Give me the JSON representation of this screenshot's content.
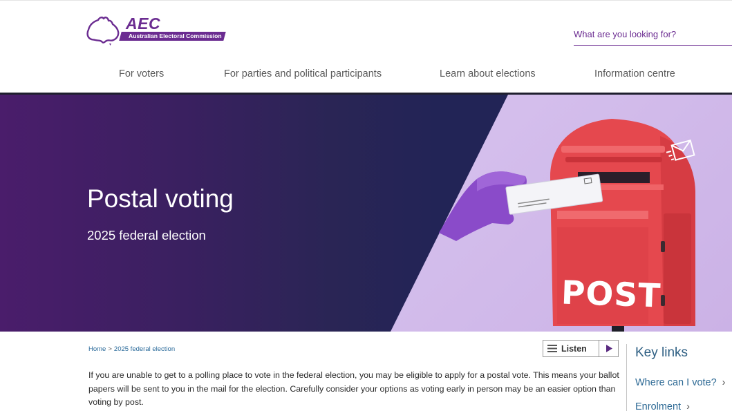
{
  "logo": {
    "abbr": "AEC",
    "full_name": "Australian Electoral Commission"
  },
  "search": {
    "placeholder": "What are you looking for?"
  },
  "nav": {
    "items": [
      {
        "label": "For voters"
      },
      {
        "label": "For parties and political participants"
      },
      {
        "label": "Learn about elections"
      },
      {
        "label": "Information centre"
      }
    ]
  },
  "hero": {
    "title": "Postal voting",
    "subtitle": "2025 federal election",
    "postbox_text": "POST"
  },
  "breadcrumb": {
    "home": "Home",
    "separator": ">",
    "current": "2025 federal election"
  },
  "listen": {
    "label": "Listen"
  },
  "main": {
    "intro": "If you are unable to get to a polling place to vote in the federal election, you may be eligible to apply for a postal vote. This means your ballot papers will be sent to you in the mail for the election. Carefully consider your options as voting early in person may be an easier option than voting by post."
  },
  "key_links": {
    "title": "Key links",
    "items": [
      {
        "label": "Where can I vote?"
      },
      {
        "label": "Enrolment"
      }
    ]
  },
  "colors": {
    "brand_purple": "#6b2c91",
    "link_blue": "#2e6a95",
    "postbox_red": "#e8454b"
  }
}
